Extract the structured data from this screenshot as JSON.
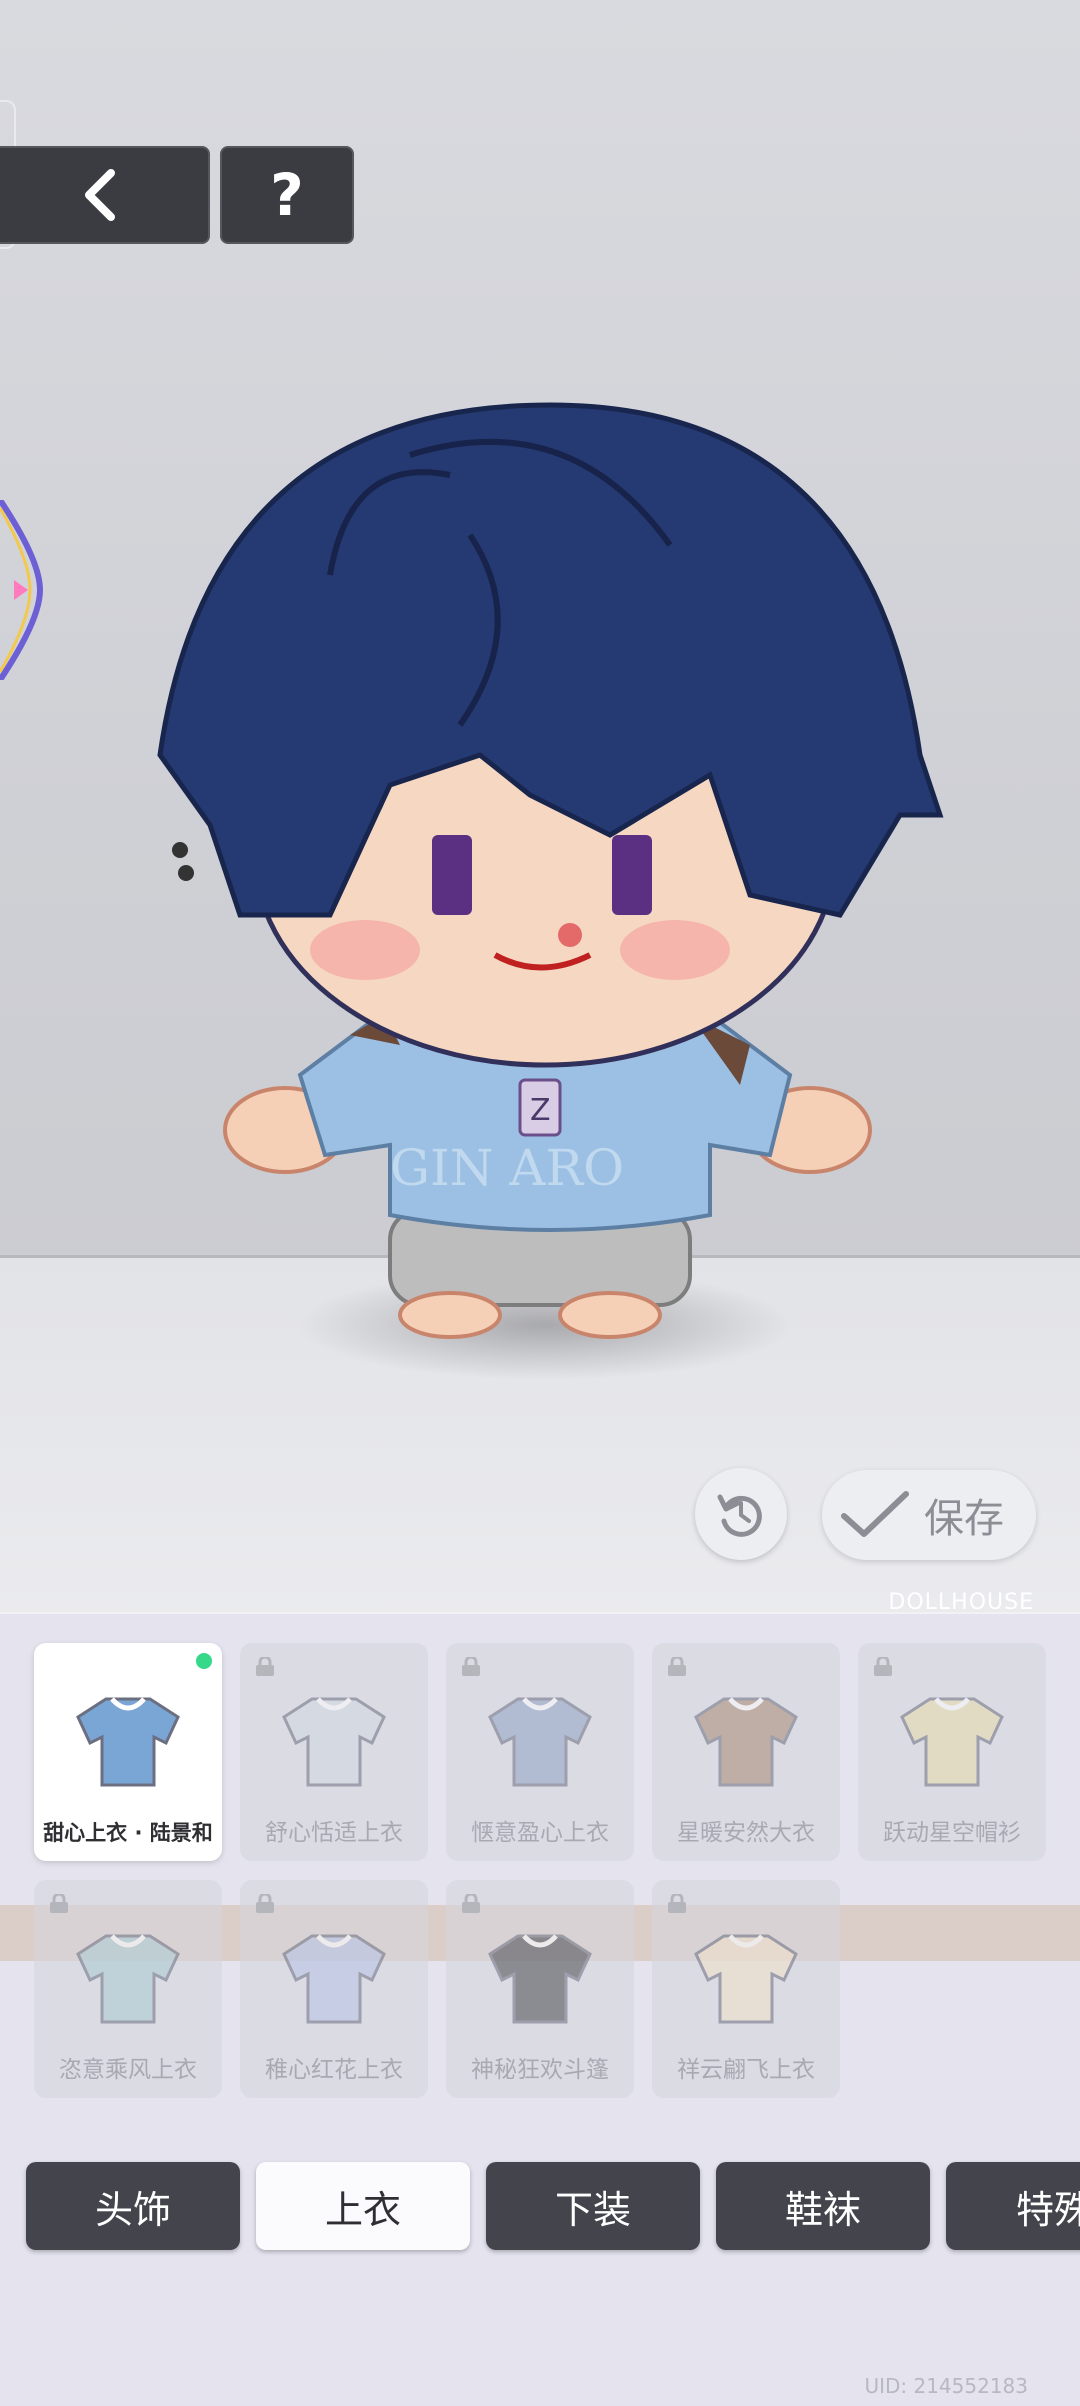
{
  "toolbar": {
    "help_label": "?"
  },
  "actions": {
    "save_label": "保存"
  },
  "panel": {
    "brand": "DOLLHOUSE",
    "items": [
      {
        "label": "甜心上衣 · 陆景和",
        "selected": true,
        "locked": false,
        "color": "#7aa6d6"
      },
      {
        "label": "舒心恬适上衣",
        "selected": false,
        "locked": true,
        "color": "#cfd8e2"
      },
      {
        "label": "惬意盈心上衣",
        "selected": false,
        "locked": true,
        "color": "#8fa2c4"
      },
      {
        "label": "星暖安然大衣",
        "selected": false,
        "locked": true,
        "color": "#a98a72"
      },
      {
        "label": "跃动星空帽衫",
        "selected": false,
        "locked": true,
        "color": "#e9dcaa"
      },
      {
        "label": "恣意乘风上衣",
        "selected": false,
        "locked": true,
        "color": "#a9cbd2"
      },
      {
        "label": "稚心红花上衣",
        "selected": false,
        "locked": true,
        "color": "#b7c3e6"
      },
      {
        "label": "神秘狂欢斗篷",
        "selected": false,
        "locked": true,
        "color": "#4a4a50"
      },
      {
        "label": "祥云翩飞上衣",
        "selected": false,
        "locked": true,
        "color": "#f1e2c8"
      }
    ]
  },
  "tabs": [
    {
      "label": "头饰",
      "active": false
    },
    {
      "label": "上衣",
      "active": true
    },
    {
      "label": "下装",
      "active": false
    },
    {
      "label": "鞋袜",
      "active": false
    },
    {
      "label": "特殊",
      "active": false
    }
  ],
  "uid": "UID: 214552183",
  "colors": {
    "hair": "#253a72",
    "sweater": "#9cc0e4",
    "shorts": "#bdbdbd",
    "accent_green": "#36d88a"
  }
}
